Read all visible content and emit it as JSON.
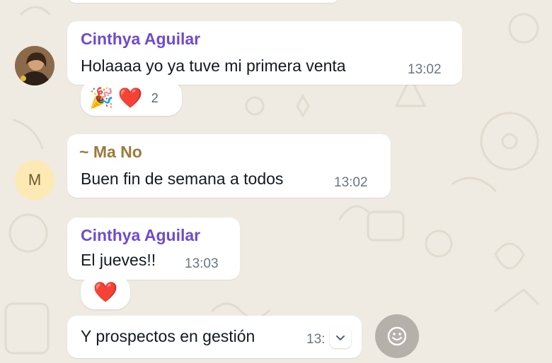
{
  "messages": [
    {
      "sender": "Cinthya Aguilar",
      "text": "Holaaaa yo ya tuve mi primera venta",
      "time": "13:02",
      "reactions": {
        "emojis": [
          "🎉",
          "❤️"
        ],
        "count": "2"
      }
    },
    {
      "sender": "~ Ma No",
      "avatar_initial": "M",
      "text": "Buen fin de semana a todos",
      "time": "13:02"
    },
    {
      "sender": "Cinthya Aguilar",
      "text": "El jueves!!",
      "time": "13:03",
      "reactions": {
        "emojis": [
          "❤️"
        ]
      }
    },
    {
      "text": "Y prospectos en gestión",
      "time": "13:"
    }
  ],
  "icons": {
    "chevron": "chevron-down-icon",
    "react": "smiley-icon",
    "party": "party-popper-icon",
    "heart": "heart-icon"
  },
  "colors": {
    "chat_background": "#efeae2",
    "sender_purple": "#6e4bd0",
    "sender_brown": "#9b7a3c",
    "avatar_yellow": "#fde9b3",
    "bubble": "#ffffff",
    "timestamp": "#667781"
  }
}
